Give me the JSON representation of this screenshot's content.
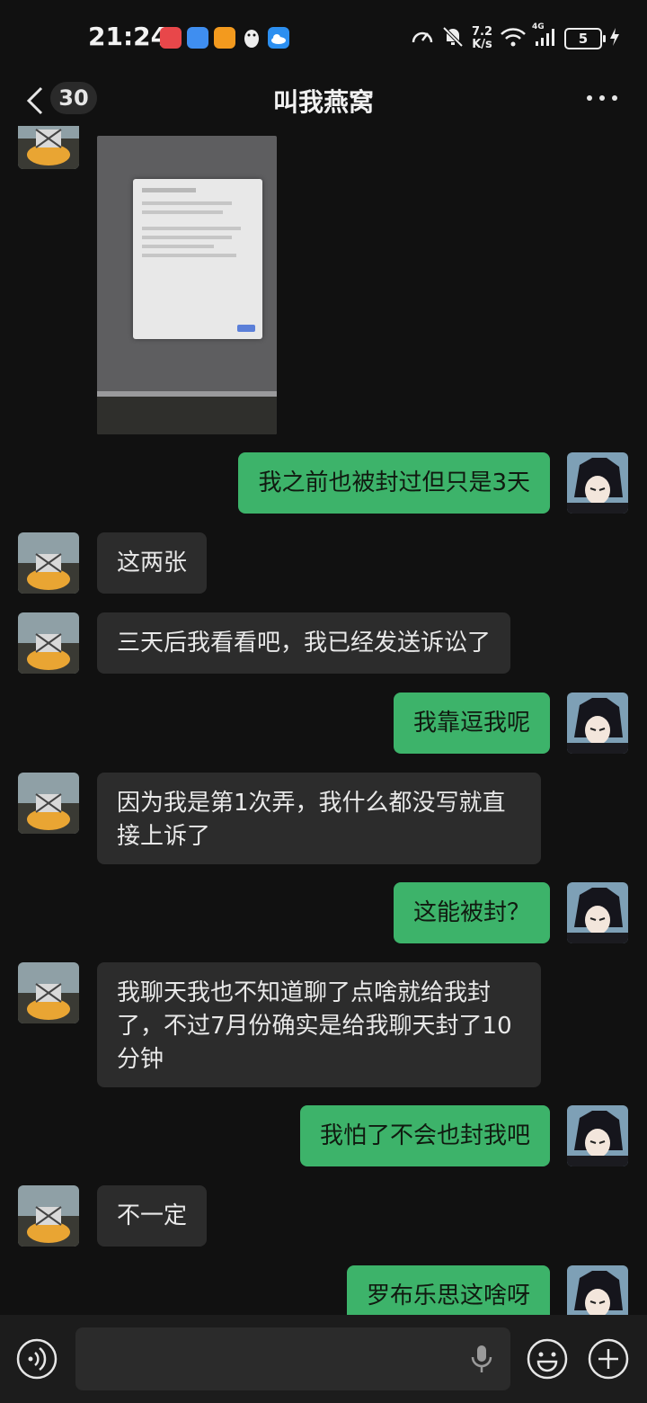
{
  "status_bar": {
    "time": "21:24",
    "net_speed_value": "7.2",
    "net_speed_unit": "K/s",
    "network_type": "4G",
    "battery_level": "5",
    "app_icons": [
      "shopping-app-icon",
      "browser-app-icon",
      "video-app-icon",
      "qq-penguin-icon",
      "weather-cloud-icon"
    ]
  },
  "header": {
    "unread_count": "30",
    "title": "叫我燕窝"
  },
  "messages": [
    {
      "side": "in",
      "type": "image"
    },
    {
      "side": "out",
      "text": "我之前也被封过但只是3天"
    },
    {
      "side": "in",
      "text": "这两张"
    },
    {
      "side": "in",
      "text": "三天后我看看吧，我已经发送诉讼了"
    },
    {
      "side": "out",
      "text": "我靠逗我呢"
    },
    {
      "side": "in",
      "text": "因为我是第1次弄，我什么都没写就直接上诉了"
    },
    {
      "side": "out",
      "text": "这能被封？"
    },
    {
      "side": "in",
      "text": "我聊天我也不知道聊了点啥就给我封了，不过7月份确实是给我聊天封了10分钟"
    },
    {
      "side": "out",
      "text": "我怕了不会也封我吧"
    },
    {
      "side": "in",
      "text": "不一定"
    },
    {
      "side": "out",
      "text": "罗布乐思这啥呀"
    }
  ],
  "input_bar": {
    "placeholder": ""
  },
  "colors": {
    "background": "#111111",
    "outgoing_bubble": "#3db36a",
    "incoming_bubble": "#2c2c2c"
  }
}
